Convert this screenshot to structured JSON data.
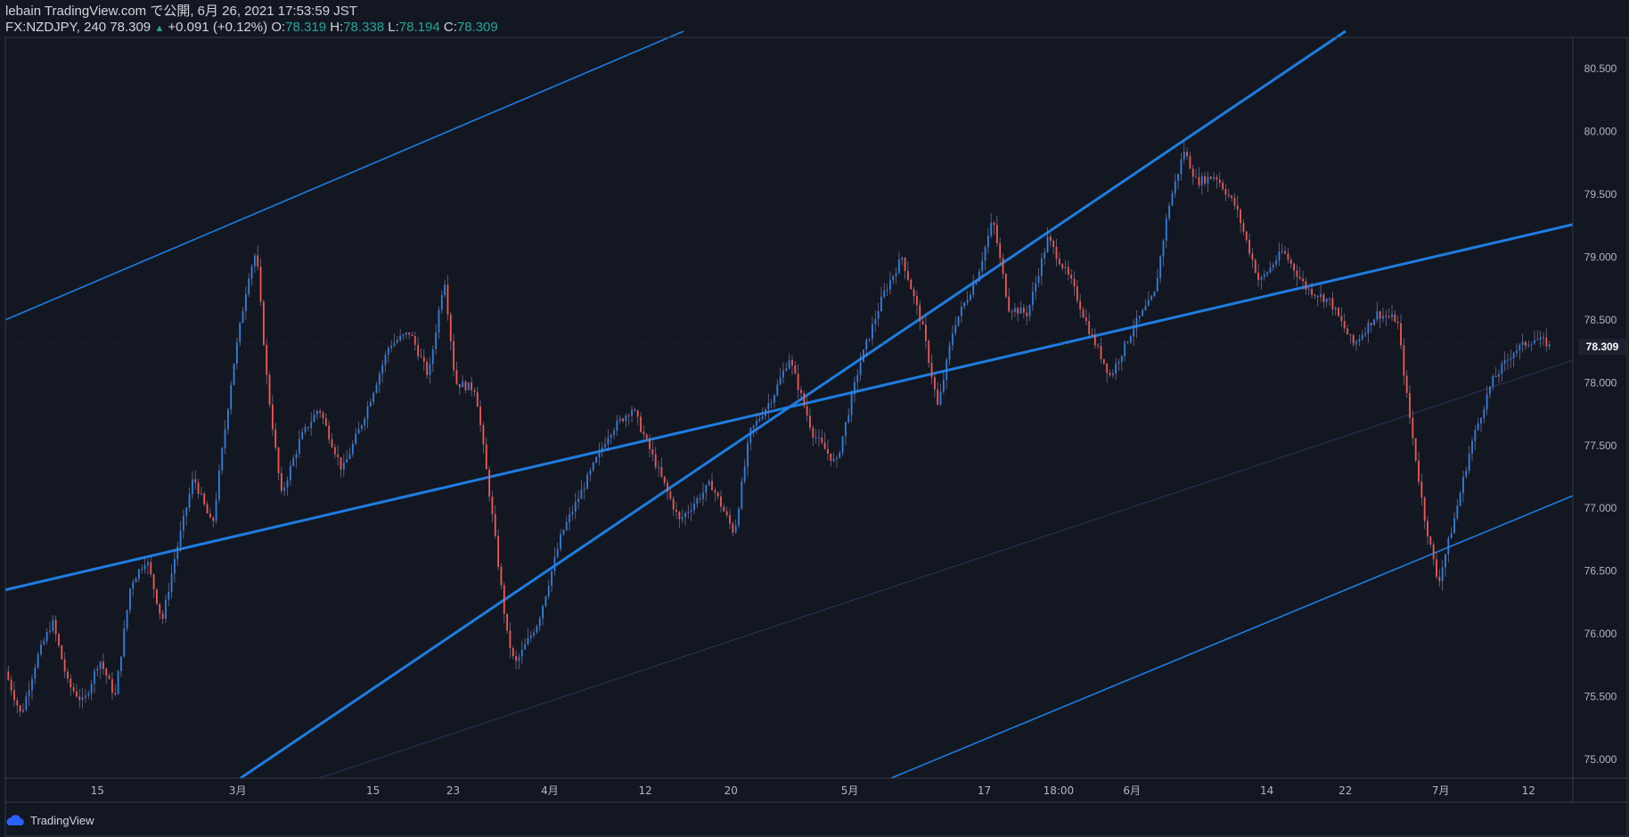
{
  "header": {
    "publisher_line": "lebain TradingView.com で公開, 6月 26, 2021 17:53:59 JST",
    "symbol_prefix": "FX:NZDJPY, 240 78.309",
    "up_arrow": "▲",
    "change": "+0.091 (+0.12%)",
    "open_label": "O:",
    "open_value": "78.319",
    "high_label": "H:",
    "high_value": "78.338",
    "low_label": "L:",
    "low_value": "78.194",
    "close_label": "C:",
    "close_value": "78.309"
  },
  "brand": {
    "name": "TradingView",
    "icon": "tradingview-cloud-icon"
  },
  "colors": {
    "background": "#131722",
    "up": "#2f7fe0",
    "down": "#f0584f",
    "channel": "#1e7de0",
    "grid_text": "#b2b5be",
    "price_label_bg": "#1e2230"
  },
  "chart_data": {
    "type": "candlestick",
    "symbol": "FX:NZDJPY",
    "interval": "240",
    "last_price": "78.309",
    "ylim": [
      74.85,
      80.75
    ],
    "yticks": [
      "75.000",
      "75.500",
      "76.000",
      "76.500",
      "77.000",
      "77.500",
      "78.000",
      "78.500",
      "79.000",
      "79.500",
      "80.000",
      "80.500"
    ],
    "xticks": [
      "15",
      "3月",
      "15",
      "23",
      "4月",
      "12",
      "20",
      "5月",
      "17",
      "18:00",
      "6月",
      "14",
      "22",
      "7月",
      "12"
    ],
    "price_path": [
      {
        "t": 0.0,
        "p": 75.7
      },
      {
        "t": 0.01,
        "p": 75.35
      },
      {
        "t": 0.02,
        "p": 75.8
      },
      {
        "t": 0.03,
        "p": 76.1
      },
      {
        "t": 0.04,
        "p": 75.6
      },
      {
        "t": 0.05,
        "p": 75.45
      },
      {
        "t": 0.06,
        "p": 75.8
      },
      {
        "t": 0.07,
        "p": 75.5
      },
      {
        "t": 0.08,
        "p": 76.4
      },
      {
        "t": 0.09,
        "p": 76.6
      },
      {
        "t": 0.1,
        "p": 76.1
      },
      {
        "t": 0.108,
        "p": 76.6
      },
      {
        "t": 0.12,
        "p": 77.25
      },
      {
        "t": 0.132,
        "p": 76.85
      },
      {
        "t": 0.145,
        "p": 78.1
      },
      {
        "t": 0.155,
        "p": 78.85
      },
      {
        "t": 0.16,
        "p": 79.05
      },
      {
        "t": 0.167,
        "p": 78.0
      },
      {
        "t": 0.176,
        "p": 77.1
      },
      {
        "t": 0.188,
        "p": 77.55
      },
      {
        "t": 0.2,
        "p": 77.8
      },
      {
        "t": 0.215,
        "p": 77.3
      },
      {
        "t": 0.228,
        "p": 77.7
      },
      {
        "t": 0.245,
        "p": 78.3
      },
      {
        "t": 0.258,
        "p": 78.4
      },
      {
        "t": 0.27,
        "p": 78.05
      },
      {
        "t": 0.28,
        "p": 78.85
      },
      {
        "t": 0.287,
        "p": 78.0
      },
      {
        "t": 0.3,
        "p": 77.95
      },
      {
        "t": 0.31,
        "p": 77.0
      },
      {
        "t": 0.32,
        "p": 76.0
      },
      {
        "t": 0.325,
        "p": 75.75
      },
      {
        "t": 0.34,
        "p": 76.1
      },
      {
        "t": 0.355,
        "p": 76.8
      },
      {
        "t": 0.37,
        "p": 77.2
      },
      {
        "t": 0.385,
        "p": 77.6
      },
      {
        "t": 0.4,
        "p": 77.8
      },
      {
        "t": 0.415,
        "p": 77.35
      },
      {
        "t": 0.43,
        "p": 76.9
      },
      {
        "t": 0.45,
        "p": 77.2
      },
      {
        "t": 0.465,
        "p": 76.8
      },
      {
        "t": 0.475,
        "p": 77.6
      },
      {
        "t": 0.49,
        "p": 77.9
      },
      {
        "t": 0.5,
        "p": 78.2
      },
      {
        "t": 0.515,
        "p": 77.6
      },
      {
        "t": 0.53,
        "p": 77.35
      },
      {
        "t": 0.545,
        "p": 78.15
      },
      {
        "t": 0.56,
        "p": 78.7
      },
      {
        "t": 0.572,
        "p": 79.0
      },
      {
        "t": 0.585,
        "p": 78.45
      },
      {
        "t": 0.595,
        "p": 77.8
      },
      {
        "t": 0.605,
        "p": 78.45
      },
      {
        "t": 0.62,
        "p": 78.85
      },
      {
        "t": 0.63,
        "p": 79.3
      },
      {
        "t": 0.64,
        "p": 78.6
      },
      {
        "t": 0.652,
        "p": 78.55
      },
      {
        "t": 0.665,
        "p": 79.15
      },
      {
        "t": 0.68,
        "p": 78.8
      },
      {
        "t": 0.692,
        "p": 78.4
      },
      {
        "t": 0.705,
        "p": 78.05
      },
      {
        "t": 0.72,
        "p": 78.45
      },
      {
        "t": 0.733,
        "p": 78.7
      },
      {
        "t": 0.742,
        "p": 79.4
      },
      {
        "t": 0.752,
        "p": 79.85
      },
      {
        "t": 0.76,
        "p": 79.6
      },
      {
        "t": 0.772,
        "p": 79.65
      },
      {
        "t": 0.785,
        "p": 79.4
      },
      {
        "t": 0.8,
        "p": 78.8
      },
      {
        "t": 0.815,
        "p": 79.05
      },
      {
        "t": 0.83,
        "p": 78.75
      },
      {
        "t": 0.845,
        "p": 78.65
      },
      {
        "t": 0.86,
        "p": 78.3
      },
      {
        "t": 0.875,
        "p": 78.55
      },
      {
        "t": 0.888,
        "p": 78.5
      },
      {
        "t": 0.895,
        "p": 77.8
      },
      {
        "t": 0.905,
        "p": 76.95
      },
      {
        "t": 0.914,
        "p": 76.4
      },
      {
        "t": 0.925,
        "p": 76.95
      },
      {
        "t": 0.935,
        "p": 77.5
      },
      {
        "t": 0.948,
        "p": 78.0
      },
      {
        "t": 0.962,
        "p": 78.25
      },
      {
        "t": 0.975,
        "p": 78.35
      },
      {
        "t": 0.985,
        "p": 78.309
      }
    ],
    "channel_lines": [
      {
        "style": "thin",
        "start": {
          "t": 0.0,
          "p": 78.5
        },
        "end": {
          "t": 0.4328,
          "p": 80.8
        }
      },
      {
        "style": "thick",
        "start": {
          "t": 0.0,
          "p": 76.35
        },
        "end": {
          "t": 1.0,
          "p": 79.26
        }
      },
      {
        "style": "thick",
        "start": {
          "t": 0.15,
          "p": 74.85
        },
        "end": {
          "t": 0.855,
          "p": 80.8
        }
      },
      {
        "style": "thin",
        "start": {
          "t": 0.565,
          "p": 74.85
        },
        "end": {
          "t": 1.0,
          "p": 77.1
        }
      },
      {
        "style": "faint",
        "start": {
          "t": 0.2,
          "p": 74.85
        },
        "end": {
          "t": 1.0,
          "p": 78.18
        }
      }
    ]
  }
}
